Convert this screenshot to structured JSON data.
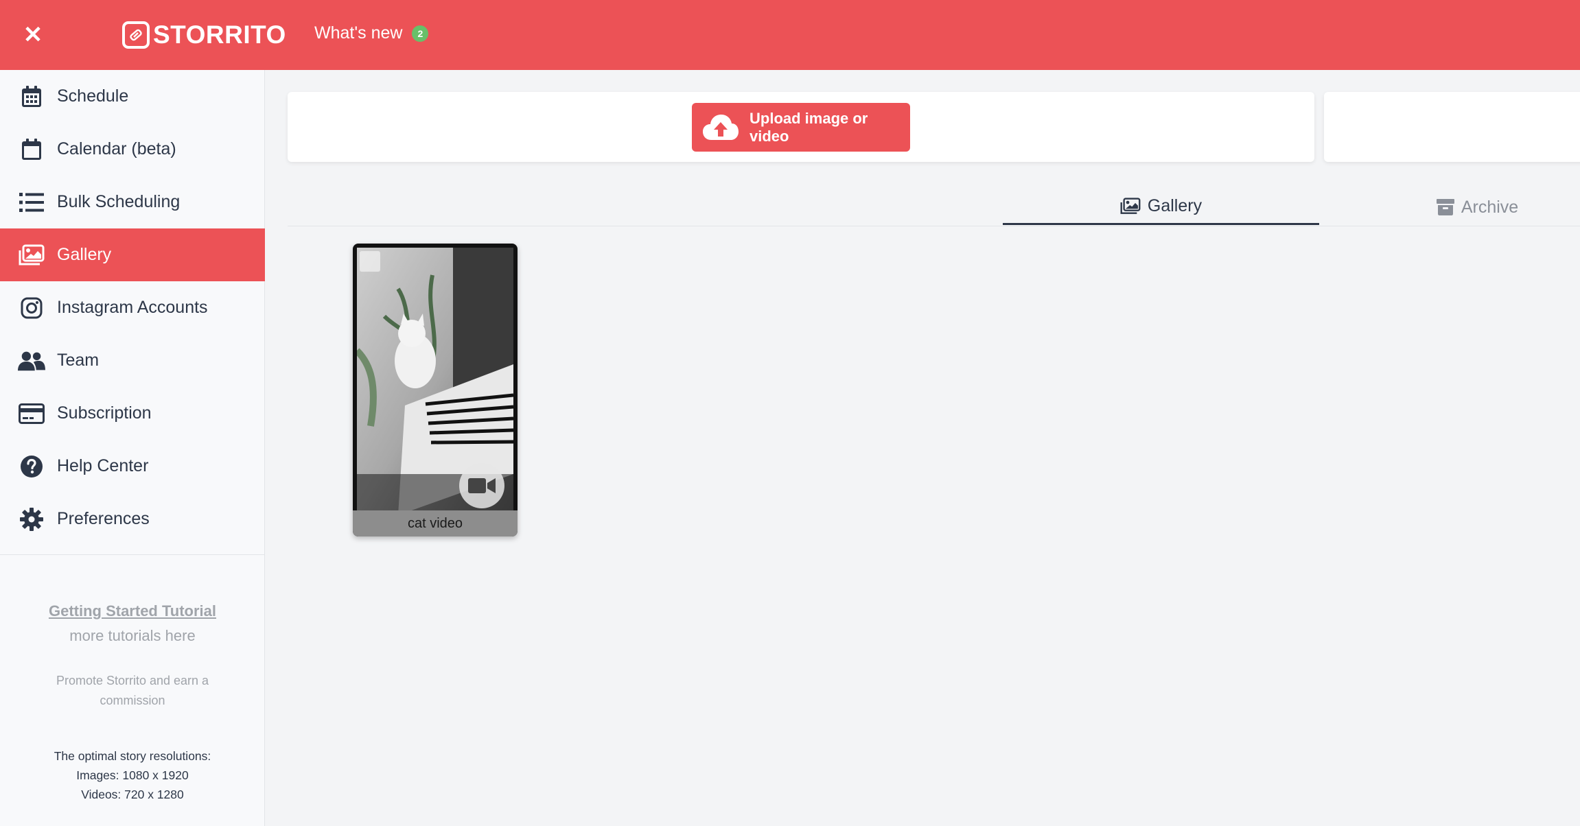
{
  "app": {
    "brand": "STORRITO",
    "whats_new_label": "What's new",
    "whats_new_count": "2",
    "brand_color": "#ec5256"
  },
  "sidebar": {
    "items": [
      {
        "label": "Schedule",
        "icon": "calendar-grid-icon",
        "active": false
      },
      {
        "label": "Calendar (beta)",
        "icon": "calendar-icon",
        "active": false
      },
      {
        "label": "Bulk Scheduling",
        "icon": "list-icon",
        "active": false
      },
      {
        "label": "Gallery",
        "icon": "images-icon",
        "active": true
      },
      {
        "label": "Instagram Accounts",
        "icon": "instagram-icon",
        "active": false
      },
      {
        "label": "Team",
        "icon": "users-icon",
        "active": false
      },
      {
        "label": "Subscription",
        "icon": "credit-card-icon",
        "active": false
      },
      {
        "label": "Help Center",
        "icon": "question-circle-icon",
        "active": false
      },
      {
        "label": "Preferences",
        "icon": "gear-icon",
        "active": false
      }
    ],
    "tutorial_link": "Getting Started Tutorial",
    "tutorial_more": "more tutorials here",
    "promote": "Promote Storrito and earn a commission",
    "resolutions_title": "The optimal story resolutions:",
    "resolutions_images": "Images: 1080 x 1920",
    "resolutions_videos": "Videos: 720 x 1280"
  },
  "main": {
    "upload_label": "Upload image or video",
    "tabs": [
      {
        "label": "Gallery",
        "icon": "images-icon",
        "active": true
      },
      {
        "label": "Archive",
        "icon": "archive-icon",
        "active": false
      }
    ],
    "gallery_items": [
      {
        "caption": "cat video",
        "type": "video"
      }
    ]
  }
}
